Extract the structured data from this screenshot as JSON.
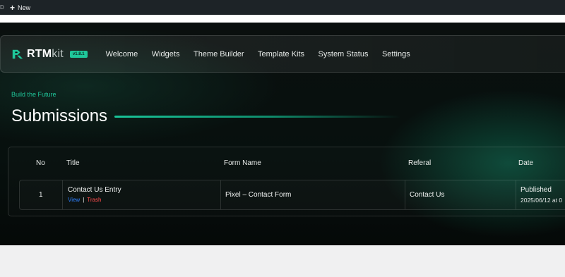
{
  "wp_toolbar": {
    "edge_glyph": "D",
    "new_label": "New",
    "new_icon": "plus-icon"
  },
  "nav": {
    "logo": {
      "text_main": "RTM",
      "text_kit": "kit",
      "version": "v1.8.1",
      "accent": "#1fc79a"
    },
    "items": [
      {
        "label": "Welcome"
      },
      {
        "label": "Widgets"
      },
      {
        "label": "Theme Builder"
      },
      {
        "label": "Template Kits"
      },
      {
        "label": "System Status"
      },
      {
        "label": "Settings"
      }
    ]
  },
  "hero": {
    "eyebrow": "Build the Future",
    "title": "Submissions"
  },
  "table": {
    "columns": [
      "No",
      "Title",
      "Form Name",
      "Referal",
      "Date"
    ],
    "rows": [
      {
        "no": "1",
        "title": "Contact Us Entry",
        "view_label": "View",
        "separator": "|",
        "trash_label": "Trash",
        "form_name": "Pixel – Contact Form",
        "referal": "Contact Us",
        "status": "Published",
        "date": "2025/06/12 at 0"
      }
    ]
  },
  "colors": {
    "accent": "#1fc79a",
    "view_link": "#2f80ff",
    "trash_link": "#ff4d4d",
    "background": "#07100e"
  }
}
